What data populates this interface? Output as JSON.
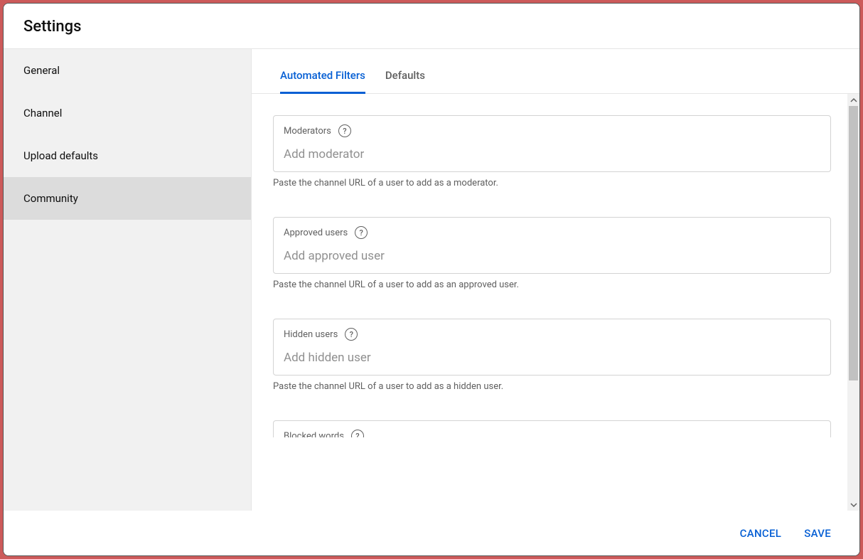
{
  "header": {
    "title": "Settings"
  },
  "sidebar": {
    "items": [
      {
        "label": "General"
      },
      {
        "label": "Channel"
      },
      {
        "label": "Upload defaults"
      },
      {
        "label": "Community"
      }
    ],
    "activeIndex": 3
  },
  "tabs": {
    "items": [
      {
        "label": "Automated Filters"
      },
      {
        "label": "Defaults"
      }
    ],
    "activeIndex": 0
  },
  "fields": {
    "moderators": {
      "label": "Moderators",
      "placeholder": "Add moderator",
      "hint": "Paste the channel URL of a user to add as a moderator."
    },
    "approved": {
      "label": "Approved users",
      "placeholder": "Add approved user",
      "hint": "Paste the channel URL of a user to add as an approved user."
    },
    "hidden": {
      "label": "Hidden users",
      "placeholder": "Add hidden user",
      "hint": "Paste the channel URL of a user to add as a hidden user."
    },
    "blocked": {
      "label": "Blocked words"
    }
  },
  "footer": {
    "cancel": "CANCEL",
    "save": "SAVE"
  },
  "helpGlyph": "?"
}
